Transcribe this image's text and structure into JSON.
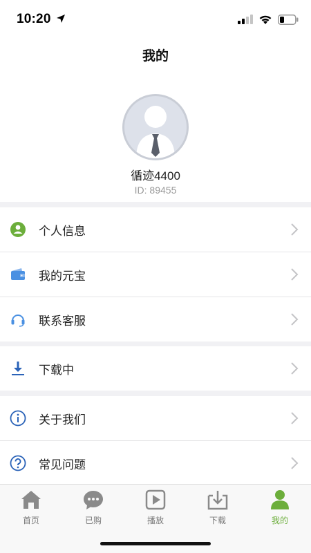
{
  "status_bar": {
    "time": "10:20"
  },
  "header": {
    "title": "我的"
  },
  "profile": {
    "username": "循迹4400",
    "user_id": "ID: 89455"
  },
  "menu": [
    {
      "label": "个人信息",
      "icon": "person-icon",
      "color": "#6cae3b"
    },
    {
      "label": "我的元宝",
      "icon": "wallet-icon",
      "color": "#4a90e2"
    },
    {
      "label": "联系客服",
      "icon": "headset-icon",
      "color": "#4a90e2"
    },
    {
      "label": "下载中",
      "icon": "download-icon",
      "color": "#2b63b8"
    },
    {
      "label": "关于我们",
      "icon": "info-icon",
      "color": "#2b63b8"
    },
    {
      "label": "常见问题",
      "icon": "question-icon",
      "color": "#2b63b8"
    }
  ],
  "tabs": [
    {
      "label": "首页",
      "icon": "home-icon",
      "active": false
    },
    {
      "label": "已购",
      "icon": "chat-bubble-icon",
      "active": false
    },
    {
      "label": "播放",
      "icon": "play-icon",
      "active": false
    },
    {
      "label": "下载",
      "icon": "download-tray-icon",
      "active": false
    },
    {
      "label": "我的",
      "icon": "profile-icon",
      "active": true
    }
  ],
  "colors": {
    "accent": "#6cae3b",
    "inactive": "#777777",
    "separator": "#f1f1f4"
  }
}
